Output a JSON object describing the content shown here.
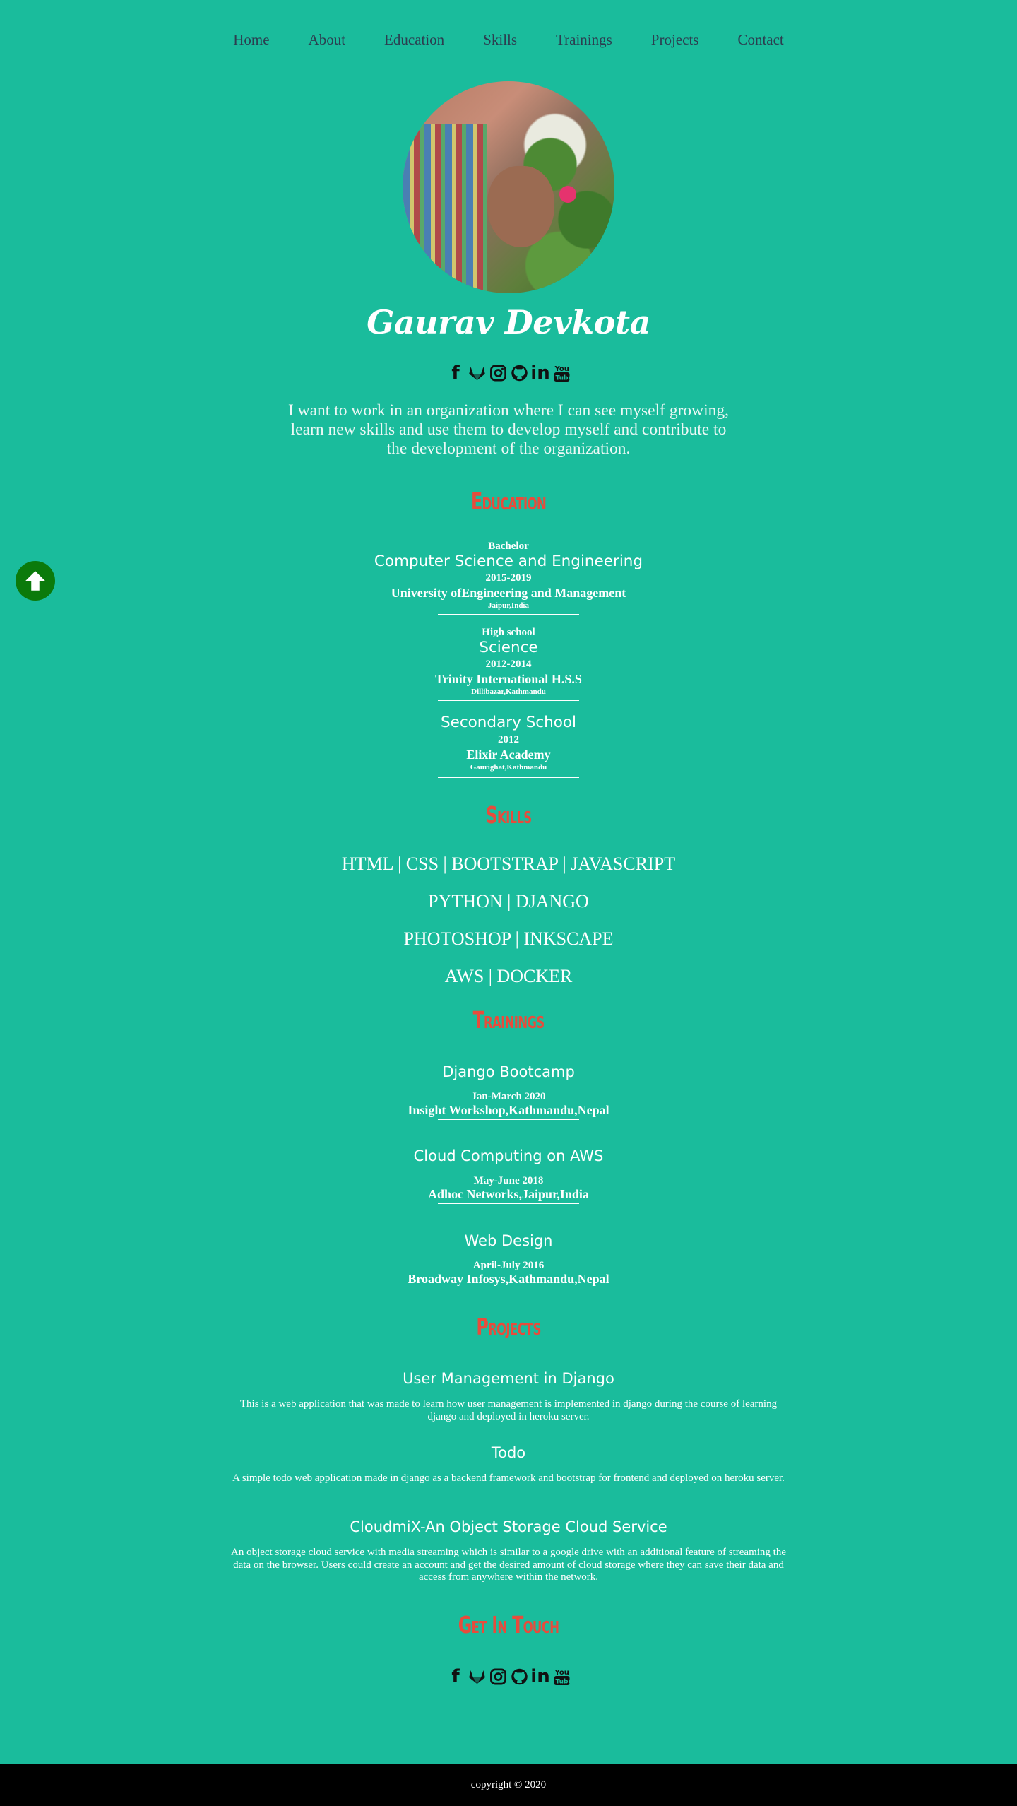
{
  "nav": {
    "items": [
      {
        "label": "Home"
      },
      {
        "label": "About"
      },
      {
        "label": "Education"
      },
      {
        "label": "Skills"
      },
      {
        "label": "Trainings"
      },
      {
        "label": "Projects"
      },
      {
        "label": "Contact"
      }
    ]
  },
  "hero": {
    "name": "Gaurav Devkota",
    "objective": "I want to work in an organization where I can see myself growing, learn new skills and use them to develop myself and contribute to the development of the organization."
  },
  "socials": [
    {
      "icon": "facebook-icon",
      "glyph": "f"
    },
    {
      "icon": "gitlab-icon",
      "glyph": "gitlab"
    },
    {
      "icon": "instagram-icon",
      "glyph": "instagram"
    },
    {
      "icon": "github-icon",
      "glyph": "github"
    },
    {
      "icon": "linkedin-icon",
      "glyph": "in"
    },
    {
      "icon": "youtube-icon",
      "glyph": "youtube"
    }
  ],
  "education": {
    "title": "Education",
    "items": [
      {
        "level": "Bachelor",
        "field": "Computer Science and Engineering",
        "years": "2015-2019",
        "institution": "University ofEngineering and Management",
        "location": "Jaipur,India"
      },
      {
        "level": "High school",
        "field": "Science",
        "years": "2012-2014",
        "institution": "Trinity International H.S.S",
        "location": "Dillibazar,Kathmandu"
      },
      {
        "level": "",
        "field": "Secondary School",
        "years": "2012",
        "institution": "Elixir Academy",
        "location": "Gaurighat,Kathmandu"
      }
    ]
  },
  "skills": {
    "title": "Skills",
    "rows": [
      "HTML | CSS | BOOTSTRAP | JAVASCRIPT",
      "PYTHON | DJANGO",
      "PHOTOSHOP | INKSCAPE",
      "AWS | DOCKER"
    ]
  },
  "trainings": {
    "title": "Trainings",
    "items": [
      {
        "name": "Django Bootcamp",
        "date": "Jan-March 2020",
        "place": "Insight Workshop,Kathmandu,Nepal"
      },
      {
        "name": "Cloud Computing on AWS",
        "date": "May-June 2018",
        "place": "Adhoc Networks,Jaipur,India"
      },
      {
        "name": "Web Design",
        "date": "April-July 2016",
        "place": "Broadway Infosys,Kathmandu,Nepal"
      }
    ]
  },
  "projects": {
    "title": "Projects",
    "items": [
      {
        "name": "User Management in Django",
        "description": "This is a web application that was made to learn how user management is implemented in django during the course of learning django and deployed in heroku server."
      },
      {
        "name": "Todo",
        "description": "A simple todo web application made in django as a backend framework and bootstrap for frontend and deployed on heroku server."
      },
      {
        "name": "CloudmiX-An Object Storage Cloud Service",
        "description": "An object storage cloud service with media streaming which is similar to a google drive with an additional feature of streaming the data on the browser. Users could create an account and get the desired amount of cloud storage where they can save their data and access from anywhere within the network."
      }
    ]
  },
  "contact": {
    "title": "Get In Touch"
  },
  "footer": {
    "copyright": "copyright © 2020"
  },
  "colors": {
    "background": "#1abc9c",
    "nav_text": "#2c3e50",
    "section_title": "#e74c3c",
    "back_to_top": "#0b7a0b",
    "footer_bg": "#000000"
  }
}
